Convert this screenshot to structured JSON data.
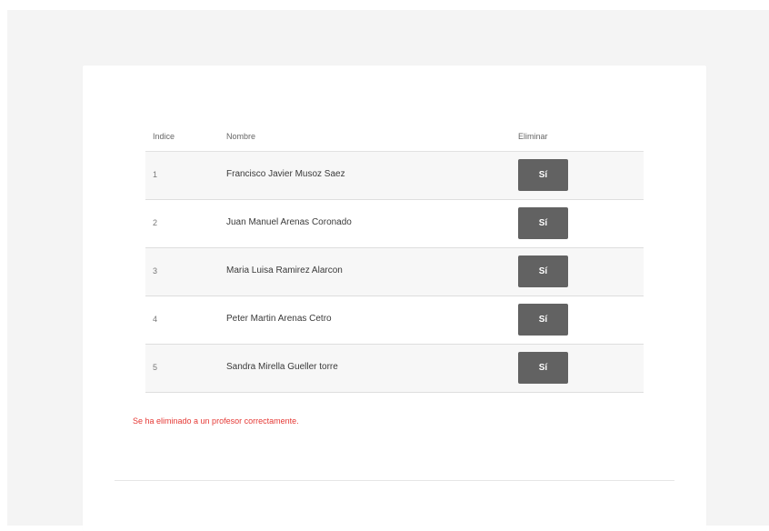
{
  "table": {
    "headers": {
      "index": "Indice",
      "name": "Nombre",
      "delete": "Eliminar"
    },
    "rows": [
      {
        "index": "1",
        "name": "Francisco Javier Musoz Saez",
        "delete_label": "Sí"
      },
      {
        "index": "2",
        "name": "Juan Manuel Arenas Coronado",
        "delete_label": "Sí"
      },
      {
        "index": "3",
        "name": "Maria Luisa Ramirez Alarcon",
        "delete_label": "Sí"
      },
      {
        "index": "4",
        "name": "Peter Martin Arenas Cetro",
        "delete_label": "Sí"
      },
      {
        "index": "5",
        "name": "Sandra Mirella Gueller torre",
        "delete_label": "Sí"
      }
    ]
  },
  "status": {
    "message": "Se ha eliminado a un profesor correctamente."
  },
  "colors": {
    "page_background": "#f4f4f4",
    "card_background": "#ffffff",
    "row_alt_background": "#f7f7f7",
    "button_background": "#626262",
    "button_text": "#ffffff",
    "status_text": "#e53935"
  }
}
